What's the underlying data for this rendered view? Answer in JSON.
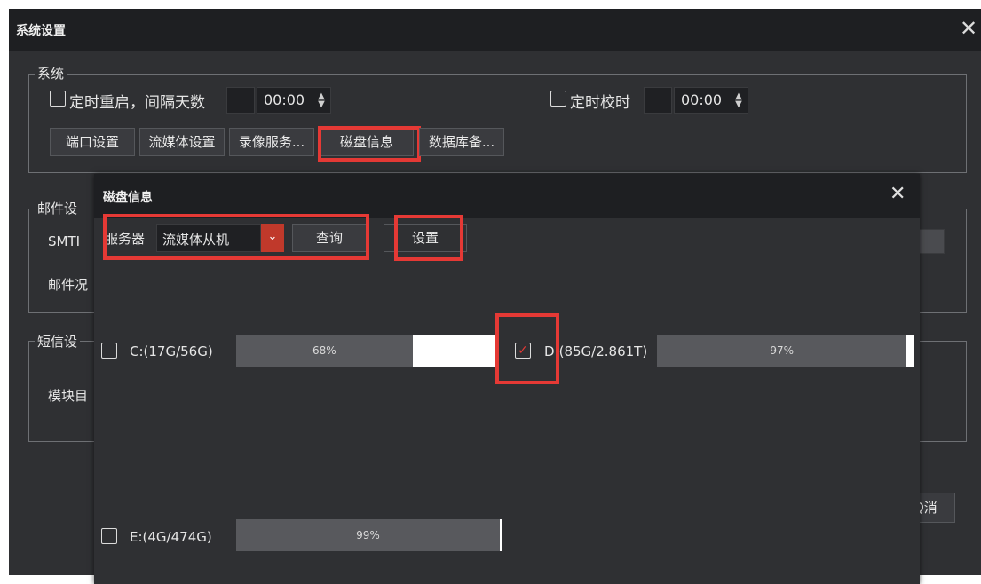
{
  "window": {
    "title": "系统设置",
    "close_icon": "close-icon"
  },
  "system_group": {
    "legend": "系统",
    "reboot_label": "定时重启，间隔天数",
    "reboot_time": "00:00",
    "timesync_label": "定时校时",
    "timesync_time": "00:00",
    "buttons": [
      "端口设置",
      "流媒体设置",
      "录像服务...",
      "磁盘信息",
      "数据库备..."
    ]
  },
  "mail_group": {
    "legend": "邮件设",
    "smtp_label": "SMTI",
    "sender_label": "邮件况"
  },
  "sms_group": {
    "legend": "短信设",
    "module_label": "模块目"
  },
  "footer": {
    "cancel_label": "Q消"
  },
  "disk_dialog": {
    "title": "磁盘信息",
    "server_label": "服务器",
    "server_value": "流媒体从机",
    "query_label": "查询",
    "settings_label": "设置",
    "disks": [
      {
        "label": "C:(17G/56G)",
        "percent_text": "68%",
        "percent": 68,
        "checked": false
      },
      {
        "label": "D:(85G/2.861T)",
        "percent_text": "97%",
        "percent": 97,
        "checked": true
      },
      {
        "label": "E:(4G/474G)",
        "percent_text": "99%",
        "percent": 99,
        "checked": false
      }
    ]
  },
  "colors": {
    "highlight": "#e53935",
    "window_bg": "#2f3033",
    "titlebar_bg": "#1e1f22",
    "bar_fill": "#58595d",
    "check_red": "#e53935"
  }
}
